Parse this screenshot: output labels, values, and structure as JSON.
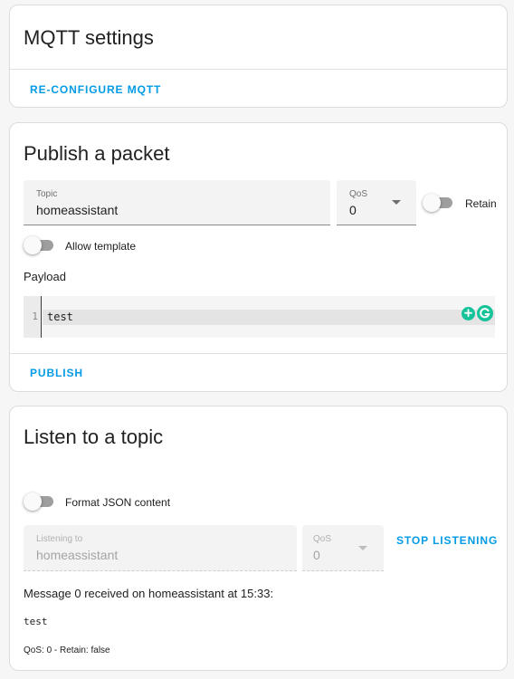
{
  "mqtt_settings": {
    "title": "MQTT settings",
    "reconfigure_label": "RE-CONFIGURE MQTT"
  },
  "publish": {
    "title": "Publish a packet",
    "topic_label": "Topic",
    "topic_value": "homeassistant",
    "qos_label": "QoS",
    "qos_value": "0",
    "retain_label": "Retain",
    "retain_on": false,
    "allow_template_label": "Allow template",
    "allow_template_on": false,
    "payload_label": "Payload",
    "editor": {
      "line_number": "1",
      "code": "test"
    },
    "publish_label": "PUBLISH"
  },
  "listen": {
    "title": "Listen to a topic",
    "format_json_label": "Format JSON content",
    "format_json_on": false,
    "listening_label": "Listening to",
    "listening_value": "homeassistant",
    "qos_label": "QoS",
    "qos_value": "0",
    "stop_label": "STOP LISTENING",
    "message": {
      "header": "Message 0 received on homeassistant at 15:33:",
      "payload": "test",
      "meta": "QoS: 0 - Retain: false"
    }
  },
  "colors": {
    "accent": "#039be5",
    "switch_off_track": "#9e9e9e",
    "grammarly_green": "#15c39a"
  }
}
